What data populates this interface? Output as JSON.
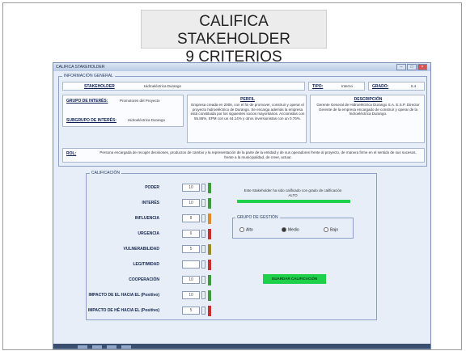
{
  "slide": {
    "title_line1": "CALIFICA STAKEHOLDER",
    "title_line2": "9 CRITERIOS"
  },
  "window": {
    "title": "CALIFICA STAKEHOLDER",
    "btn_min": "–",
    "btn_max": "□",
    "btn_close": "×"
  },
  "info": {
    "caption": "INFORMACIÓN GENERAL",
    "stakeholder_label": "STAKEHOLDER",
    "stakeholder_value": "Hidroeléctrica Durango",
    "tipo_label": "TIPO:",
    "tipo_value": "Interno",
    "grado_label": "GRADO:",
    "grado_value": "5.4",
    "grupo_label": "GRUPO DE INTERÉS:",
    "grupo_value": "Promotores del Proyecto",
    "subgrupo_label": "SUBGRUPO DE INTERÉS:",
    "subgrupo_value": "Hidroeléctrica Durango",
    "perfil_label": "PERFIL",
    "perfil_text": "Empresa creada en 2006, con el fin de promover, construir y operar el proyecto hidroeléctrico de Durango. Se encarga además la empresa está constituida por los siguientes socios mayoritarios. Accionistas con 55.86%, EPM con un 44.14% y otros inversionistas con un 0.76%.",
    "descripcion_label": "DESCRIPCIÓN",
    "descripcion_text": "Gerente General de Hidroeléctrica Durango S.A. E.S.P. Director Gerente de la empresa encargado de construir y operar de la hidroeléctrica Durango.",
    "rol_label": "ROL:",
    "rol_text": "Persona encargada de recoger decisiones, productos de cambio y la representación de la parte de la entidad y de sus operadores frente al proyecto, de manera firme en el sentido de sus sucesos, frente a la municipalidad, de creer, actuar."
  },
  "calificacion": {
    "caption": "CALIFICACIÓN",
    "criteria": [
      {
        "label": "PODER",
        "value": "10",
        "color": "#3a9d3a"
      },
      {
        "label": "INTERÉS",
        "value": "10",
        "color": "#3a9d3a"
      },
      {
        "label": "INFLUENCIA",
        "value": "8",
        "color": "#e08a2a"
      },
      {
        "label": "URGENCIA",
        "value": "6",
        "color": "#c8302c"
      },
      {
        "label": "VULNERABILIDAD",
        "value": "5",
        "color": "#9a8a2a"
      },
      {
        "label": "LEGITIMIDAD",
        "value": "",
        "color": "#c8302c"
      },
      {
        "label": "COOPERACIÓN",
        "value": "10",
        "color": "#3a9d3a"
      },
      {
        "label": "IMPACTO DE EL HACIA EL (Positivo)",
        "value": "10",
        "color": "#3a9d3a"
      },
      {
        "label": "IMPACTO DE HÉ HACIA EL (Positivo)",
        "value": "5",
        "color": "#c8302c"
      }
    ],
    "result_text": "Este Stakeholder ha sido calificado con grado de calificación ALTO",
    "grupo_box": {
      "caption": "GRUPO DE GESTIÓN",
      "options": [
        "Alto",
        "Medio",
        "Bajo"
      ],
      "selected": "Medio"
    },
    "guardar_label": "GUARDAR CALIFICACIÓN"
  },
  "colors": {
    "green": "#1fd14a",
    "accent_group": "#8aa0c4"
  }
}
